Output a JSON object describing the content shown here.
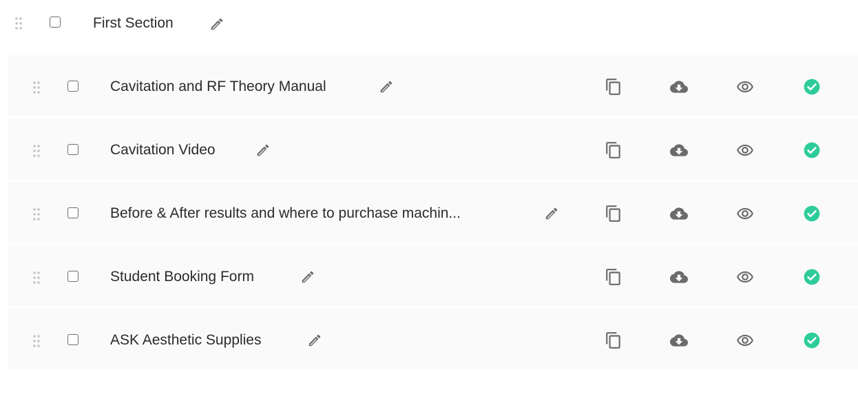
{
  "section": {
    "title": "First Section"
  },
  "items": [
    {
      "title": "Cavitation and RF Theory Manual"
    },
    {
      "title": "Cavitation Video"
    },
    {
      "title": "Before & After results and where to purchase machin..."
    },
    {
      "title": "Student Booking Form"
    },
    {
      "title": "ASK Aesthetic Supplies"
    }
  ],
  "colors": {
    "status_published": "#2ecc9a",
    "icon": "#6b6b6b",
    "row_background": "#fafafa"
  }
}
